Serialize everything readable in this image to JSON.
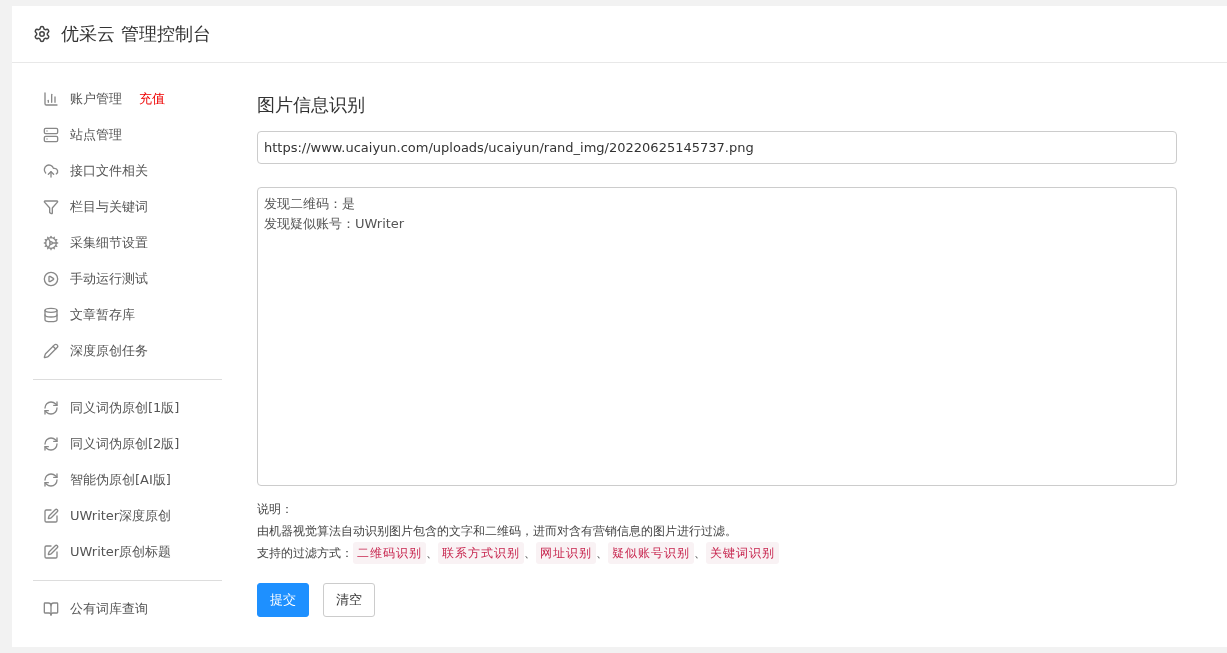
{
  "header": {
    "title": "优采云 管理控制台"
  },
  "sidebar": {
    "groups": [
      {
        "items": [
          {
            "label": "账户管理",
            "badge": "充值"
          },
          {
            "label": "站点管理"
          },
          {
            "label": "接口文件相关"
          },
          {
            "label": "栏目与关键词"
          },
          {
            "label": "采集细节设置"
          },
          {
            "label": "手动运行测试"
          },
          {
            "label": "文章暂存库"
          },
          {
            "label": "深度原创任务"
          }
        ]
      },
      {
        "items": [
          {
            "label": "同义词伪原创[1版]"
          },
          {
            "label": "同义词伪原创[2版]"
          },
          {
            "label": "智能伪原创[AI版]"
          },
          {
            "label": "UWriter深度原创"
          },
          {
            "label": "UWriter原创标题"
          }
        ]
      },
      {
        "items": [
          {
            "label": "公有词库查询"
          }
        ]
      }
    ]
  },
  "main": {
    "title": "图片信息识别",
    "url_field": {
      "value": "https://www.ucaiyun.com/uploads/ucaiyun/rand_img/20220625145737.png"
    },
    "result_lines": [
      "发现二维码：是",
      "发现疑似账号：UWriter"
    ],
    "notes": {
      "heading": "说明：",
      "description": "由机器视觉算法自动识别图片包含的文字和二维码，进而对含有营销信息的图片进行过滤。",
      "methods_label": "支持的过滤方式：",
      "separator": "、",
      "methods": [
        "二维码识别",
        "联系方式识别",
        "网址识别",
        "疑似账号识别",
        "关键词识别"
      ]
    },
    "buttons": [
      {
        "label": "提交",
        "kind": "primary"
      },
      {
        "label": "清空",
        "kind": "default"
      }
    ]
  }
}
